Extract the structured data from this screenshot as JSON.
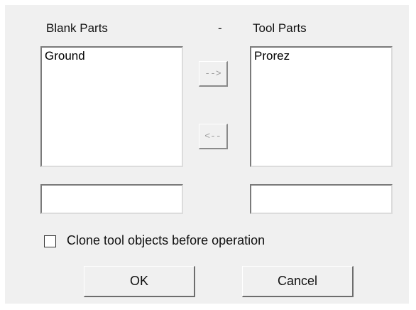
{
  "blank_parts": {
    "label": "Blank Parts",
    "items": [
      "Ground"
    ],
    "field_value": ""
  },
  "separator_dot": "-",
  "tool_parts": {
    "label": "Tool Parts",
    "items": [
      "Prorez"
    ],
    "field_value": ""
  },
  "buttons": {
    "move_right": "-->",
    "move_left": "<--",
    "ok": "OK",
    "cancel": "Cancel"
  },
  "options": {
    "clone_label": "Clone tool objects before operation",
    "clone_checked": false
  }
}
